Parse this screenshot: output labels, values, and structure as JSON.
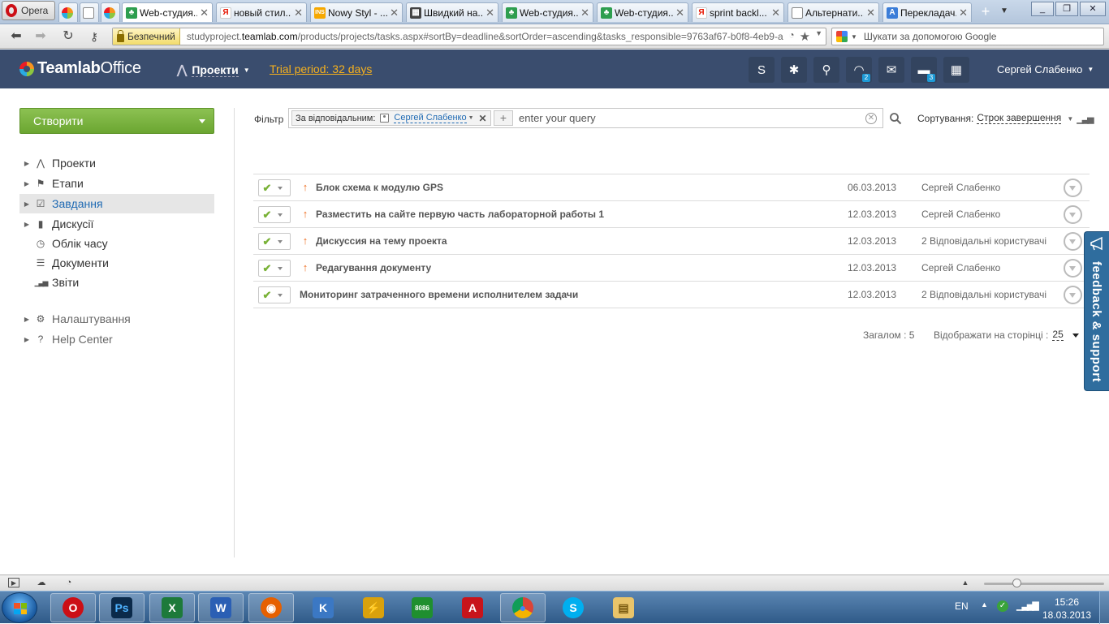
{
  "browser": {
    "menu_label": "Opera",
    "tabs": [
      {
        "title": "Web-студия...",
        "favicon": "teamlab"
      },
      {
        "title": "новый стил...",
        "favicon": "yandex"
      },
      {
        "title": "Nowy Styl - ...",
        "favicon": "ins"
      },
      {
        "title": "Швидкий на...",
        "favicon": "grid"
      },
      {
        "title": "Web-студия...",
        "favicon": "teamlab"
      },
      {
        "title": "Web-студия...",
        "favicon": "teamlab"
      },
      {
        "title": "sprint backl...",
        "favicon": "yandex"
      },
      {
        "title": "Альтернати...",
        "favicon": "page"
      },
      {
        "title": "Перекладач...",
        "favicon": "translate"
      }
    ],
    "security_label": "Безпечний",
    "url_prefix": "studyproject.",
    "url_domain": "teamlab.com",
    "url_path": "/products/projects/tasks.aspx#sortBy=deadline&sortOrder=ascending&tasks_responsible=9763af67-b0f8-4eb9-a",
    "search_placeholder": "Шукати за допомогою Google"
  },
  "app": {
    "logo_text": "TeamlabOffice",
    "logo_text_a": "Teamlab",
    "logo_text_b": "Office",
    "module_label": "Проекти",
    "trial_label": "Trial period: 32 days",
    "header_icons": [
      {
        "name": "skype-icon",
        "glyph": "S",
        "badge": ""
      },
      {
        "name": "settings-icon",
        "glyph": "✱",
        "badge": ""
      },
      {
        "name": "search-icon",
        "glyph": "⚲",
        "badge": ""
      },
      {
        "name": "feed-icon",
        "glyph": "◠",
        "badge": "2"
      },
      {
        "name": "mail-icon",
        "glyph": "✉",
        "badge": ""
      },
      {
        "name": "chat-icon",
        "glyph": "▬",
        "badge": "3"
      },
      {
        "name": "calendar-icon",
        "glyph": "▦",
        "badge": ""
      }
    ],
    "user_name": "Сергей Слабенко"
  },
  "sidebar": {
    "create_label": "Створити",
    "items": [
      {
        "label": "Проекти",
        "icon": "projects-icon",
        "arrow": true
      },
      {
        "label": "Етапи",
        "icon": "flag-icon",
        "arrow": true
      },
      {
        "label": "Завдання",
        "icon": "tasks-icon",
        "arrow": true,
        "active": true
      },
      {
        "label": "Дискусії",
        "icon": "discussions-icon",
        "arrow": true
      },
      {
        "label": "Облік часу",
        "icon": "clock-icon",
        "arrow": false
      },
      {
        "label": "Документи",
        "icon": "documents-icon",
        "arrow": false
      },
      {
        "label": "Звіти",
        "icon": "reports-icon",
        "arrow": false
      }
    ],
    "secondary": [
      {
        "label": "Налаштування",
        "icon": "gear-icon"
      },
      {
        "label": "Help Center",
        "icon": "help-icon"
      }
    ]
  },
  "filter": {
    "label": "Фільтр",
    "chip_label": "За відповідальним:",
    "chip_value": "Сергей Слабенко",
    "query_placeholder": "enter your query",
    "sort_label": "Сортування:",
    "sort_value": "Строк завершення"
  },
  "tasks": [
    {
      "title": "Блок схема к модулю GPS",
      "priority": "high",
      "deadline": "06.03.2013",
      "responsible": "Сергей Слабенко"
    },
    {
      "title": "Разместить на сайте первую часть лабораторной работы 1",
      "priority": "high",
      "deadline": "12.03.2013",
      "responsible": "Сергей Слабенко"
    },
    {
      "title": "Дискуссия на тему проекта",
      "priority": "high",
      "deadline": "12.03.2013",
      "responsible": "2 Відповідальні користувачі"
    },
    {
      "title": "Редагування документу",
      "priority": "high",
      "deadline": "12.03.2013",
      "responsible": "Сергей Слабенко"
    },
    {
      "title": "Мониторинг затраченного времени исполнителем задачи",
      "priority": "normal",
      "deadline": "12.03.2013",
      "responsible": "2 Відповідальні користувачі"
    }
  ],
  "pagination": {
    "total_label": "Загалом : 5",
    "per_page_label": "Відображати на сторінці :",
    "per_page_value": "25"
  },
  "feedback_label": "feedback & support",
  "taskbar": {
    "apps": [
      "opera",
      "photoshop",
      "excel",
      "word",
      "firefox",
      "app-k",
      "app-lightning",
      "emu8086",
      "acrobat",
      "chrome",
      "skype",
      "explorer"
    ],
    "emu_label": "8086",
    "lang": "EN",
    "time": "15:26",
    "date": "18.03.2013"
  }
}
